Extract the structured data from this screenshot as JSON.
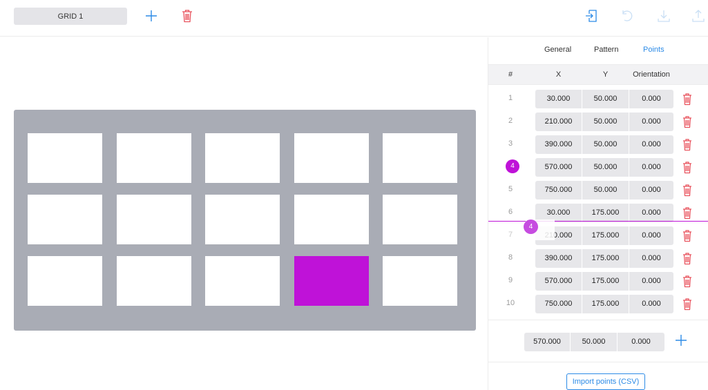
{
  "toolbar": {
    "grid_name": "GRID 1",
    "icons": [
      "plus-icon",
      "trash-icon",
      "import-icon",
      "undo-icon",
      "download-icon",
      "export-icon"
    ]
  },
  "colors": {
    "accent": "#2b8ae6",
    "selection": "#bf12d8",
    "danger": "#e8505b",
    "board": "#a9acb5"
  },
  "panel": {
    "tabs": [
      {
        "label": "General",
        "active": false
      },
      {
        "label": "Pattern",
        "active": false
      },
      {
        "label": "Points",
        "active": true
      }
    ],
    "columns": [
      "#",
      "X",
      "Y",
      "Orientation"
    ],
    "points": [
      {
        "n": "1",
        "x": "30.000",
        "y": "50.000",
        "o": "0.000"
      },
      {
        "n": "2",
        "x": "210.000",
        "y": "50.000",
        "o": "0.000"
      },
      {
        "n": "3",
        "x": "390.000",
        "y": "50.000",
        "o": "0.000"
      },
      {
        "n": "4",
        "x": "570.000",
        "y": "50.000",
        "o": "0.000"
      },
      {
        "n": "5",
        "x": "750.000",
        "y": "50.000",
        "o": "0.000"
      },
      {
        "n": "6",
        "x": "30.000",
        "y": "175.000",
        "o": "0.000"
      },
      {
        "n": "7",
        "x": "210.000",
        "y": "175.000",
        "o": "0.000"
      },
      {
        "n": "8",
        "x": "390.000",
        "y": "175.000",
        "o": "0.000"
      },
      {
        "n": "9",
        "x": "570.000",
        "y": "175.000",
        "o": "0.000"
      },
      {
        "n": "10",
        "x": "750.000",
        "y": "175.000",
        "o": "0.000"
      }
    ],
    "selected_point": "4",
    "drag_badge": "4",
    "new_point": {
      "x": "570.000",
      "y": "50.000",
      "o": "0.000"
    },
    "import_label": "Import points (CSV)"
  },
  "board": {
    "rows": 3,
    "cols": 5,
    "active_cell": "row 3, column 4"
  }
}
